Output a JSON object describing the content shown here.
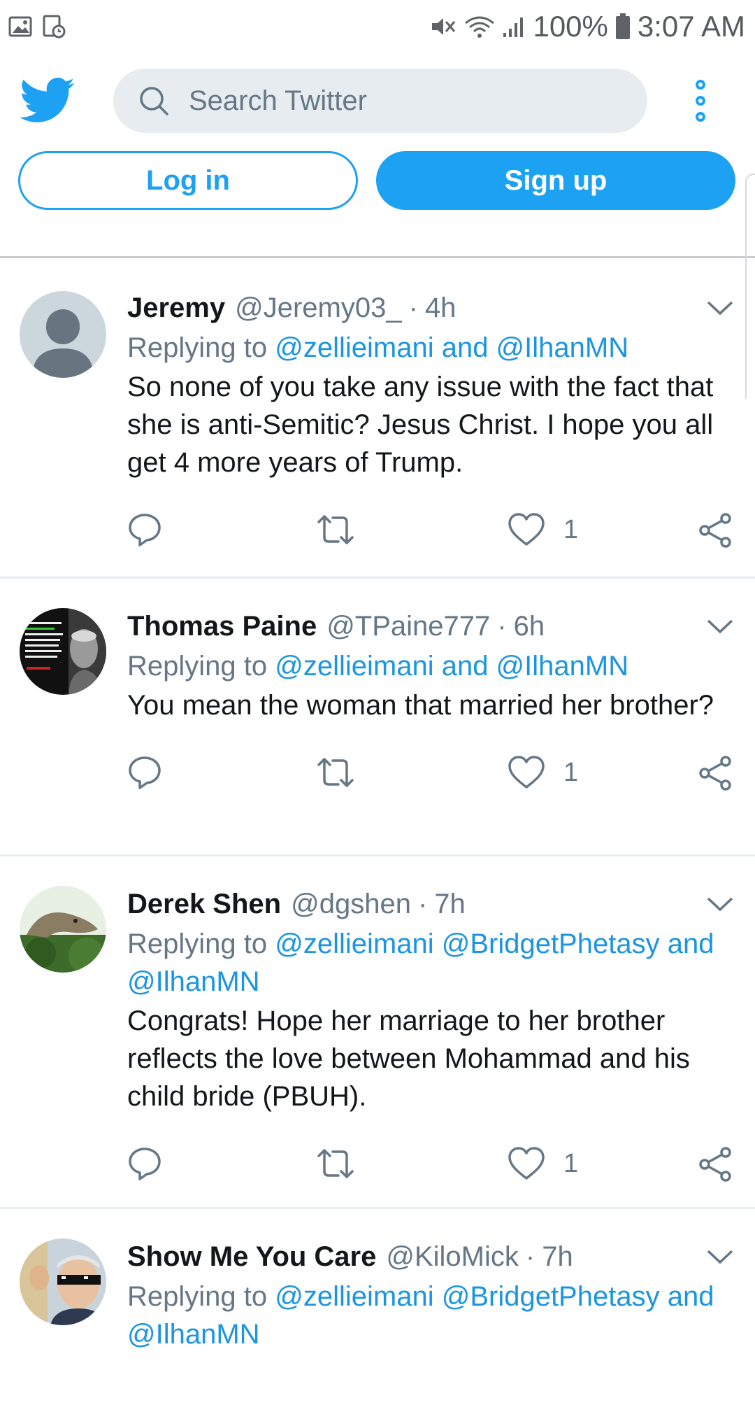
{
  "status_bar": {
    "battery": "100%",
    "time": "3:07 AM"
  },
  "search": {
    "placeholder": "Search Twitter"
  },
  "auth": {
    "login_label": "Log in",
    "signup_label": "Sign up"
  },
  "colors": {
    "accent": "#1da1f2",
    "mention": "#1b95e0",
    "secondary_text": "#657786"
  },
  "tweets": [
    {
      "name": "Jeremy",
      "handle": "@Jeremy03_",
      "time": "4h",
      "replying_label": "Replying to",
      "replying_to": "@zellieimani and @IlhanMN",
      "text": "So none of you take any issue with the fact that she is anti-Semitic? Jesus Christ. I hope you all get 4 more years of Trump.",
      "likes": "1"
    },
    {
      "name": "Thomas Paine",
      "handle": "@TPaine777",
      "time": "6h",
      "replying_label": "Replying to",
      "replying_to": "@zellieimani and @IlhanMN",
      "text": "You mean the woman that married her brother?",
      "likes": "1"
    },
    {
      "name": "Derek Shen",
      "handle": "@dgshen",
      "time": "7h",
      "replying_label": "Replying to",
      "replying_to": "@zellieimani @BridgetPhetasy and @IlhanMN",
      "text": "Congrats! Hope her marriage to her brother reflects the love between Mohammad and his child bride (PBUH).",
      "likes": "1"
    },
    {
      "name": "Show Me You Care",
      "handle": "@KiloMick",
      "time": "7h",
      "replying_label": "Replying to",
      "replying_to": "@zellieimani @BridgetPhetasy and @IlhanMN"
    }
  ]
}
